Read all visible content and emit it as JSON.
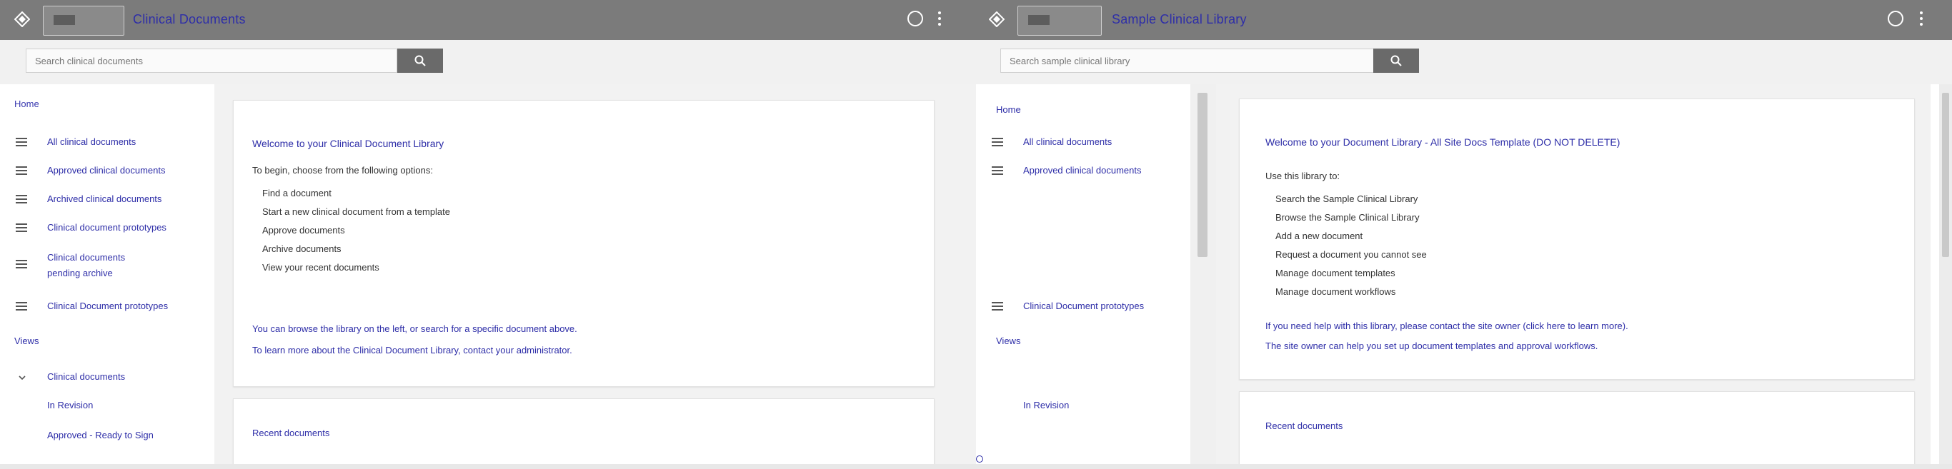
{
  "left": {
    "header": {
      "title": "Clinical Documents",
      "tab_label": ""
    },
    "search": {
      "placeholder": "Search clinical documents",
      "value": ""
    },
    "sidebar": {
      "home": "Home",
      "items": [
        {
          "label": "All clinical documents"
        },
        {
          "label": "Approved clinical documents"
        },
        {
          "label": "Archived clinical documents"
        },
        {
          "label": "Clinical document prototypes"
        },
        {
          "label": "Clinical documents pending archive"
        },
        {
          "label": "Clinical Document prototypes"
        }
      ],
      "section_label": "Views",
      "group_label": "Clinical documents",
      "sub_items": [
        {
          "label": "In Revision"
        },
        {
          "label": "Approved - Ready to Sign"
        }
      ]
    },
    "card": {
      "welcome": "Welcome to your Clinical Document Library",
      "intro": "To begin, choose from the following options:",
      "bullets": [
        "Find a document",
        "Start a new clinical document from a template",
        "Approve documents",
        "Archive documents",
        "View your recent documents"
      ],
      "note": "You can browse the library on the left, or search for a specific document above.",
      "note2": "To learn more about the Clinical Document Library, contact your administrator."
    },
    "card2": {
      "label": "Recent documents"
    }
  },
  "right": {
    "header": {
      "title": "Sample Clinical Library",
      "tab_label": ""
    },
    "search": {
      "placeholder": "Search sample clinical library",
      "value": ""
    },
    "sidebar": {
      "home": "Home",
      "items": [
        {
          "label": "All clinical documents"
        },
        {
          "label": "Approved clinical documents"
        },
        {
          "label": "Clinical Document prototypes"
        }
      ],
      "section_label": "Views",
      "sub_items": [
        {
          "label": "In Revision"
        }
      ]
    },
    "card": {
      "welcome": "Welcome to your Document Library - All Site Docs Template (DO NOT DELETE)",
      "intro": "Use this library to:",
      "bullets": [
        "Search the Sample Clinical Library",
        "Browse the Sample Clinical Library",
        "Add a new document",
        "Request a document you cannot see",
        "Manage document templates",
        "Manage document workflows"
      ],
      "note": "If you need help with this library, please contact the site owner (click here to learn more).",
      "note2": "The site owner can help you set up document templates and approval workflows."
    },
    "card2": {
      "label": "Recent documents"
    }
  }
}
